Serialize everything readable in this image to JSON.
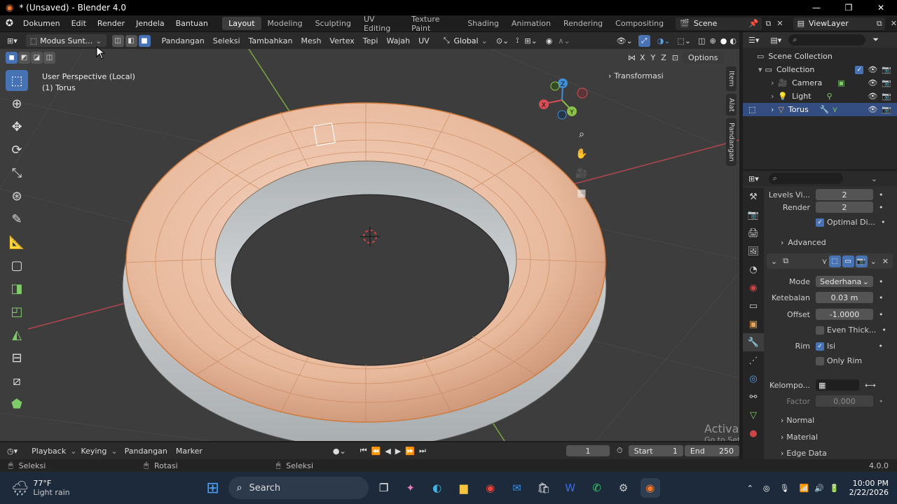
{
  "titlebar": {
    "title": "* (Unsaved) - Blender 4.0",
    "min": "—",
    "max": "❐",
    "close": "✕"
  },
  "menus": [
    "Dokumen",
    "Edit",
    "Render",
    "Jendela",
    "Bantuan"
  ],
  "workspaces": [
    "Layout",
    "Modeling",
    "Sculpting",
    "UV Editing",
    "Texture Paint",
    "Shading",
    "Animation",
    "Rendering",
    "Compositing"
  ],
  "scene": {
    "name": "Scene",
    "viewlayer": "ViewLayer"
  },
  "viewport_header": {
    "mode": "Modus Sunt...",
    "menus": [
      "Pandangan",
      "Seleksi",
      "Tambahkan",
      "Mesh",
      "Vertex",
      "Tepi",
      "Wajah",
      "UV"
    ],
    "orientation": "Global",
    "options": "Options",
    "axes": [
      "X",
      "Y",
      "Z"
    ]
  },
  "viewport": {
    "perspective": "User Perspective (Local)",
    "object": "(1) Torus",
    "transform_panel": "Transformasi",
    "gizmo": {
      "x": "X",
      "y": "Y",
      "z": "Z"
    }
  },
  "sidetabs": [
    "Item",
    "Alat",
    "Pandangan"
  ],
  "outliner": {
    "root": "Scene Collection",
    "collection": "Collection",
    "items": [
      "Camera",
      "Light",
      "Torus"
    ]
  },
  "properties": {
    "levels_viewport_label": "Levels Vi...",
    "levels_viewport": "2",
    "render_label": "Render",
    "render": "2",
    "optimal_label": "Optimal Di...",
    "advanced": "Advanced",
    "mode_label": "Mode",
    "mode": "Sederhana",
    "thickness_label": "Ketebalan",
    "thickness": "0.03 m",
    "offset_label": "Offset",
    "offset": "-1.0000",
    "even_label": "Even Thick...",
    "rim_label": "Rim",
    "fill_label": "Isi",
    "only_rim_label": "Only Rim",
    "vgroup_label": "Kelompo...",
    "factor_label": "Factor",
    "factor": "0.000",
    "sections": [
      "Normal",
      "Material",
      "Edge Data"
    ]
  },
  "timeline": {
    "menus": [
      "Playback",
      "Keying",
      "Pandangan",
      "Marker"
    ],
    "current_frame": "1",
    "start_label": "Start",
    "start": "1",
    "end_label": "End",
    "end": "250"
  },
  "statusbar": {
    "left": "Seleksi",
    "middle": "Rotasi",
    "right": "Seleksi",
    "version": "4.0.0"
  },
  "watermark": {
    "line1": "Activate Windows",
    "line2": "Go to Settings to activate Windows."
  },
  "taskbar": {
    "temp": "77°F",
    "weather": "Light rain",
    "search": "Search",
    "time": "10:00 PM",
    "date": "2/22/2026"
  },
  "colors": {
    "accent": "#4772b3",
    "torus_outer": "#e8b99c",
    "torus_inner": "#c9cdcf",
    "x_axis": "#d94e55",
    "y_axis": "#8bc34a",
    "z_axis": "#3f8fd9"
  }
}
